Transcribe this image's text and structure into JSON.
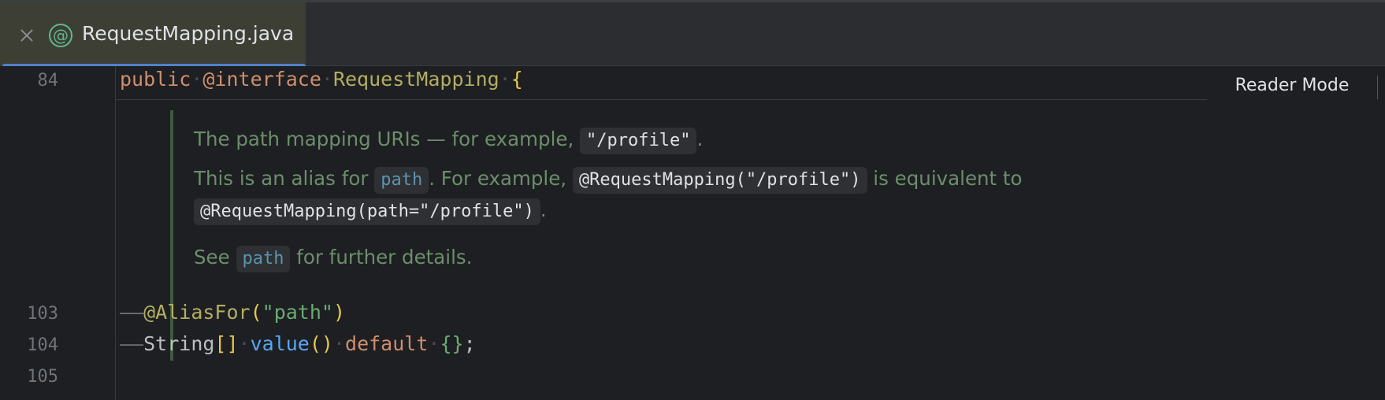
{
  "tab": {
    "label": "RequestMapping.java",
    "icon": "annotation-icon",
    "icon_glyph": "@"
  },
  "editor": {
    "reader_mode": "Reader Mode",
    "lines": {
      "l84": {
        "num": "84",
        "kw_public": "public",
        "kw_interface": "@interface",
        "name": "RequestMapping",
        "brace": "{"
      },
      "l103": {
        "num": "103",
        "guide": "——",
        "ann": "@AliasFor",
        "open": "(",
        "str": "\"path\"",
        "close": ")"
      },
      "l104": {
        "num": "104",
        "guide": "——",
        "type": "String",
        "brackets": "[]",
        "fn": "value",
        "parens": "()",
        "kw_default": "default",
        "braces": "{}",
        "semi": ";"
      },
      "l105": {
        "num": "105"
      }
    },
    "doc": {
      "p1": {
        "text": "The path mapping URIs — for example, ",
        "code": "\"/profile\"",
        "end": "."
      },
      "p2": {
        "t1": "This is an alias for ",
        "link": "path",
        "t2": ". For example, ",
        "code1": "@RequestMapping(\"/profile\")",
        "t3": " is equivalent to"
      },
      "p3": {
        "code": "@RequestMapping(path=\"/profile\")",
        "end": "."
      },
      "p4": {
        "t1": "See ",
        "link": "path",
        "t2": " for further details."
      }
    }
  }
}
